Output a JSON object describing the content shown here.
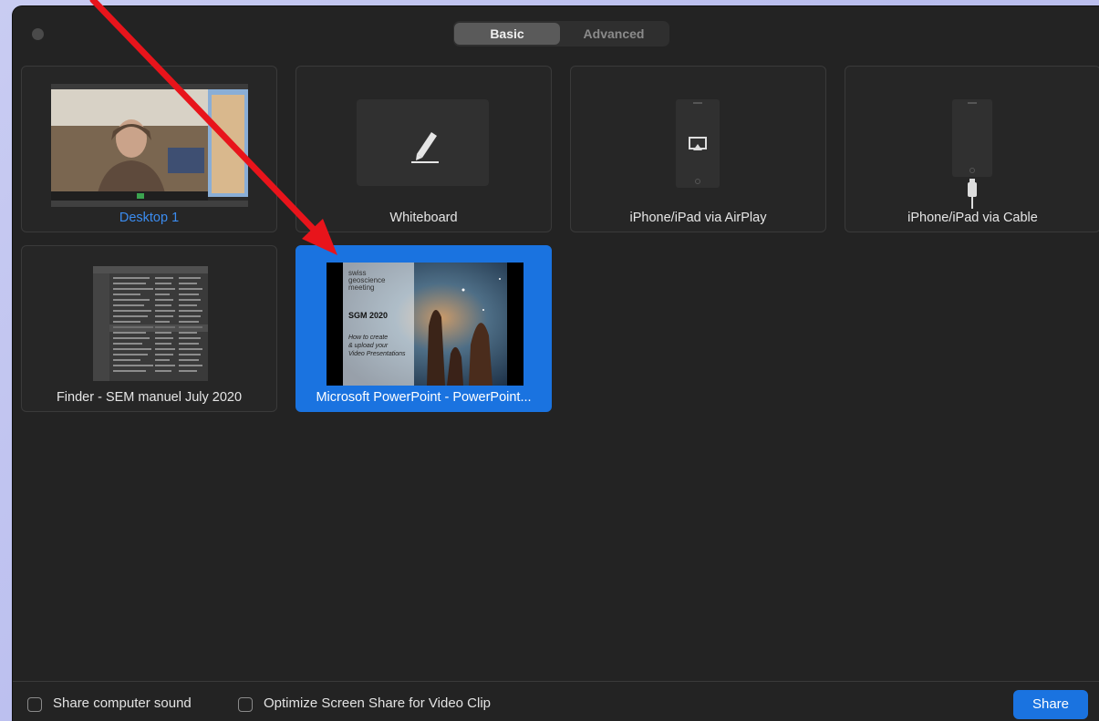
{
  "tabs": {
    "basic": "Basic",
    "advanced": "Advanced"
  },
  "tiles": [
    {
      "label": "Desktop 1"
    },
    {
      "label": "Whiteboard"
    },
    {
      "label": "iPhone/iPad via AirPlay"
    },
    {
      "label": "iPhone/iPad via Cable"
    },
    {
      "label": "Finder - SEM manuel July 2020"
    },
    {
      "label": "Microsoft PowerPoint - PowerPoint..."
    }
  ],
  "slide": {
    "brand_line1": "swiss",
    "brand_line2": "geoscience",
    "brand_line3": "meeting",
    "title": "SGM 2020",
    "sub1": "How to create",
    "sub2": "& upload your",
    "sub3": "Video Presentations"
  },
  "bottom": {
    "share_sound": "Share computer sound",
    "optimize": "Optimize Screen Share for Video Clip",
    "share_button": "Share"
  },
  "colors": {
    "accent": "#1a73e0",
    "annotation_arrow": "#e8141b"
  }
}
